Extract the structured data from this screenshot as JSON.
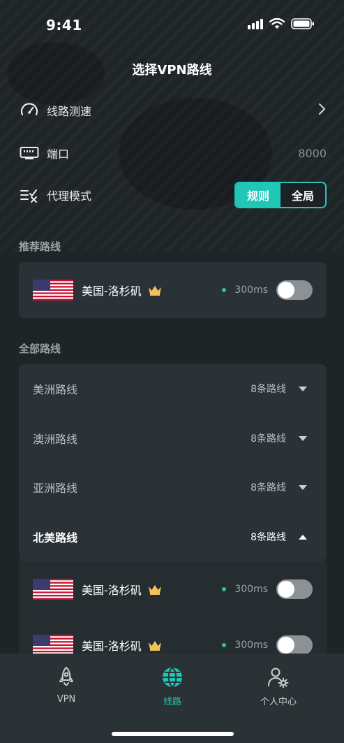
{
  "status_bar": {
    "time": "9:41",
    "icons": [
      "signal-icon",
      "wifi-icon",
      "battery-icon"
    ]
  },
  "header": {
    "title": "选择VPN路线"
  },
  "settings": {
    "speed_test": {
      "label": "线路测速",
      "icon": "speedometer-icon"
    },
    "port": {
      "label": "端口",
      "value": "8000",
      "icon": "port-icon"
    },
    "proxy_mode": {
      "label": "代理模式",
      "icon": "proxy-mode-icon",
      "options": [
        "规则",
        "全局"
      ],
      "selected": "规则"
    }
  },
  "recommended": {
    "title": "推荐路线",
    "server": {
      "name": "美国-洛杉矶",
      "ping": "300ms",
      "enabled": false
    }
  },
  "all_routes": {
    "title": "全部路线",
    "groups": [
      {
        "label": "美洲路线",
        "count": "8条路线",
        "expanded": false
      },
      {
        "label": "澳洲路线",
        "count": "8条路线",
        "expanded": false
      },
      {
        "label": "亚洲路线",
        "count": "8条路线",
        "expanded": false
      },
      {
        "label": "北美路线",
        "count": "8条路线",
        "expanded": true
      }
    ],
    "expanded_servers": [
      {
        "name": "美国-洛杉矶",
        "ping": "300ms",
        "enabled": false
      },
      {
        "name": "美国-洛杉矶",
        "ping": "300ms",
        "enabled": false
      }
    ]
  },
  "tab_bar": {
    "tabs": [
      {
        "label": "VPN",
        "icon": "rocket-icon",
        "active": false
      },
      {
        "label": "线路",
        "icon": "globe-icon",
        "active": true
      },
      {
        "label": "个人中心",
        "icon": "user-settings-icon",
        "active": false
      }
    ]
  },
  "colors": {
    "accent": "#20c6b6",
    "background": "#1f2427",
    "card": "#2a3237",
    "online": "#2ecc71"
  }
}
